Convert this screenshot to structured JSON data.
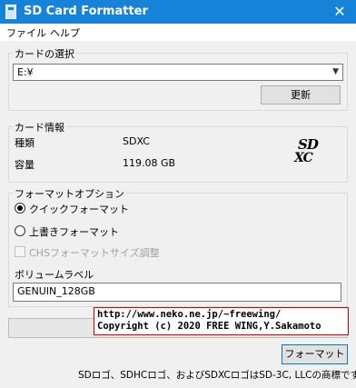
{
  "window": {
    "title": "SD Card Formatter",
    "close_glyph": "✕"
  },
  "menu": {
    "file": "ファイル",
    "help": "ヘルプ"
  },
  "card_select": {
    "legend": "カードの選択",
    "selected": "E:¥",
    "refresh_label": "更新"
  },
  "card_info": {
    "legend": "カード情報",
    "type_label": "種類",
    "type_value": "SDXC",
    "capacity_label": "容量",
    "capacity_value": "119.08 GB",
    "logo_top": "SD",
    "logo_bottom": "XC"
  },
  "format_options": {
    "legend": "フォーマットオプション",
    "quick_label": "クイックフォーマット",
    "overwrite_label": "上書きフォーマット",
    "chs_label": "CHSフォーマットサイズ調整",
    "selected_option": "quick"
  },
  "volume": {
    "label": "ボリュームラベル",
    "value": "GENUIN_128GB"
  },
  "overlay": {
    "line1": "http://www.neko.ne.jp/~freewing/",
    "line2": "Copyright (c) 2020 FREE WING,Y.Sakamoto"
  },
  "progress": {
    "value": 0
  },
  "format_button": "フォーマット",
  "footer": "SDロゴ、SDHCロゴ、およびSDXCロゴはSD-3C, LLCの商標です。",
  "colors": {
    "titlebar": "#1683d8",
    "accent": "#0078d7",
    "overlay_border": "#d40000"
  }
}
